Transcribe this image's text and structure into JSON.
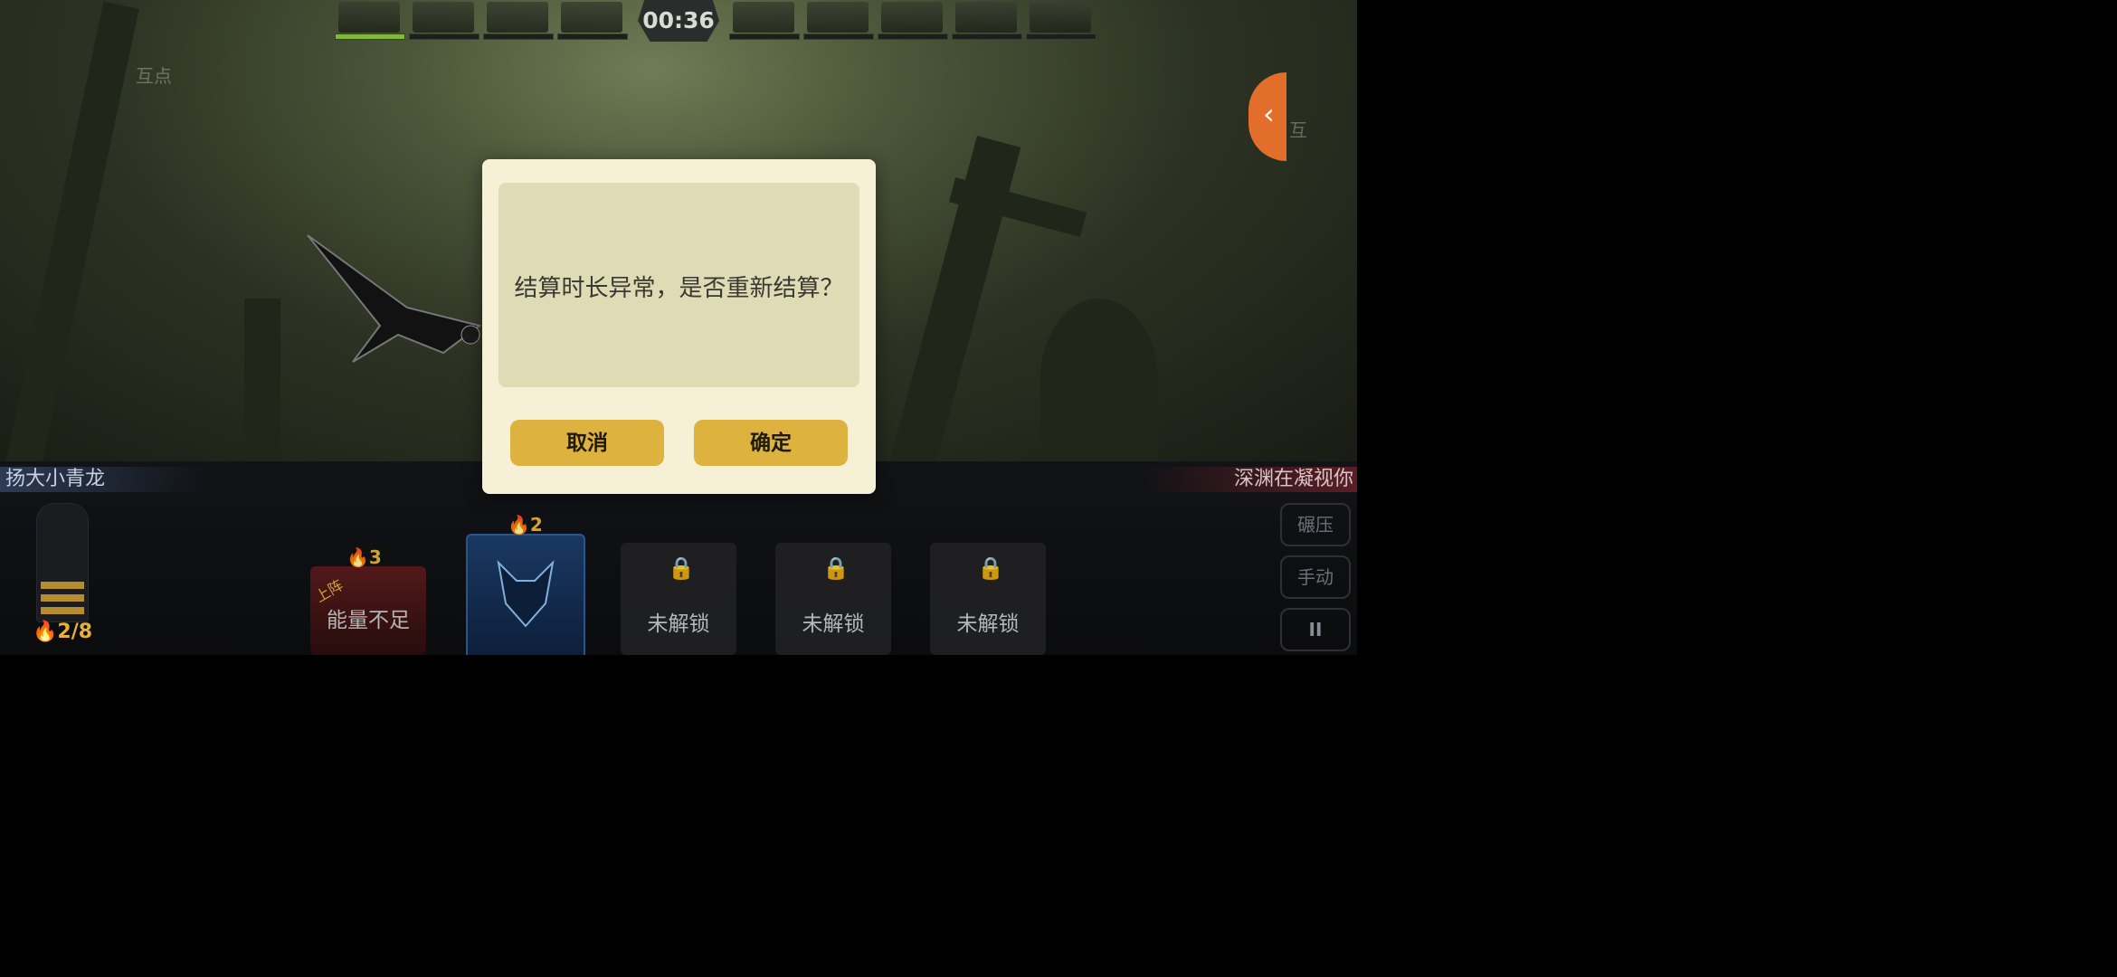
{
  "hud": {
    "timer": "00:36",
    "watermark_left": "互点",
    "watermark_right": "互"
  },
  "players": {
    "left_name": "扬大小青龙",
    "right_name": "深渊在凝视你"
  },
  "energy": {
    "text": "2/8",
    "level_fraction": 0.25
  },
  "cards": [
    {
      "cost": "3",
      "tag": "上阵",
      "label": "能量不足",
      "state": "insufficient"
    },
    {
      "cost": "2",
      "tag": "",
      "label": "",
      "state": "ready"
    },
    {
      "cost": "",
      "tag": "",
      "label": "未解锁",
      "state": "locked"
    },
    {
      "cost": "",
      "tag": "",
      "label": "未解锁",
      "state": "locked"
    },
    {
      "cost": "",
      "tag": "",
      "label": "未解锁",
      "state": "locked"
    }
  ],
  "controls": {
    "button1": "碾压",
    "button2": "手动",
    "pause": "II"
  },
  "dialog": {
    "message": "结算时长异常，是否重新结算？",
    "cancel_label": "取消",
    "confirm_label": "确定"
  },
  "colors": {
    "dialog_bg": "#f5f0d6",
    "button": "#deb23e",
    "side_tab": "#e36d2a",
    "energy": "#e6b23a"
  }
}
